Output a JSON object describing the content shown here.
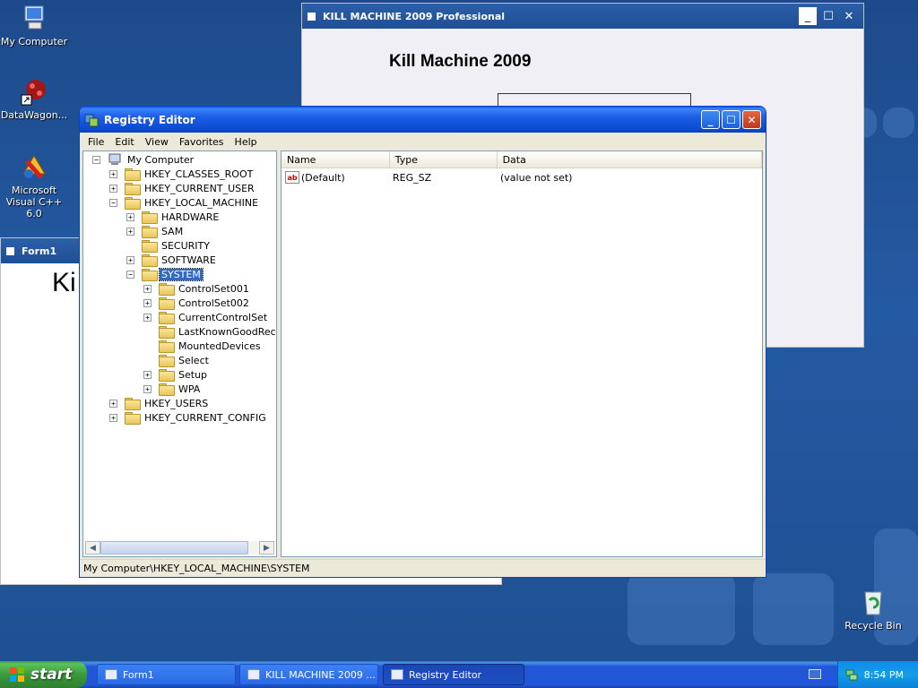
{
  "desktop": {
    "icons": [
      {
        "label": "My Computer",
        "icon": "my-computer-icon"
      },
      {
        "label": "DataWagon...",
        "icon": "datawagon-icon"
      },
      {
        "label": "Microsoft Visual C++ 6.0",
        "icon": "visual-cpp-icon"
      },
      {
        "label": "Recycle Bin",
        "icon": "recycle-bin-icon"
      }
    ]
  },
  "kill_machine_window": {
    "title": "KILL MACHINE 2009 Professional",
    "heading": "Kill Machine 2009"
  },
  "form1_window": {
    "title": "Form1",
    "heading_partial": "Ki"
  },
  "registry_editor": {
    "title": "Registry Editor",
    "menu": [
      "File",
      "Edit",
      "View",
      "Favorites",
      "Help"
    ],
    "tree": {
      "root": "My Computer",
      "hives": {
        "classes_root": "HKEY_CLASSES_ROOT",
        "current_user": "HKEY_CURRENT_USER",
        "local_machine": "HKEY_LOCAL_MACHINE",
        "users": "HKEY_USERS",
        "current_config": "HKEY_CURRENT_CONFIG"
      },
      "local_machine_children": [
        "HARDWARE",
        "SAM",
        "SECURITY",
        "SOFTWARE",
        "SYSTEM"
      ],
      "system_children": [
        "ControlSet001",
        "ControlSet002",
        "CurrentControlSet",
        "LastKnownGoodRecove",
        "MountedDevices",
        "Select",
        "Setup",
        "WPA"
      ]
    },
    "columns": [
      "Name",
      "Type",
      "Data"
    ],
    "values": [
      {
        "name": "(Default)",
        "type": "REG_SZ",
        "data": "(value not set)"
      }
    ],
    "status_path": "My Computer\\HKEY_LOCAL_MACHINE\\SYSTEM"
  },
  "taskbar": {
    "start_label": "start",
    "tasks": [
      "Form1",
      "KILL MACHINE 2009 ...",
      "Registry Editor"
    ],
    "clock": "8:54 PM"
  }
}
